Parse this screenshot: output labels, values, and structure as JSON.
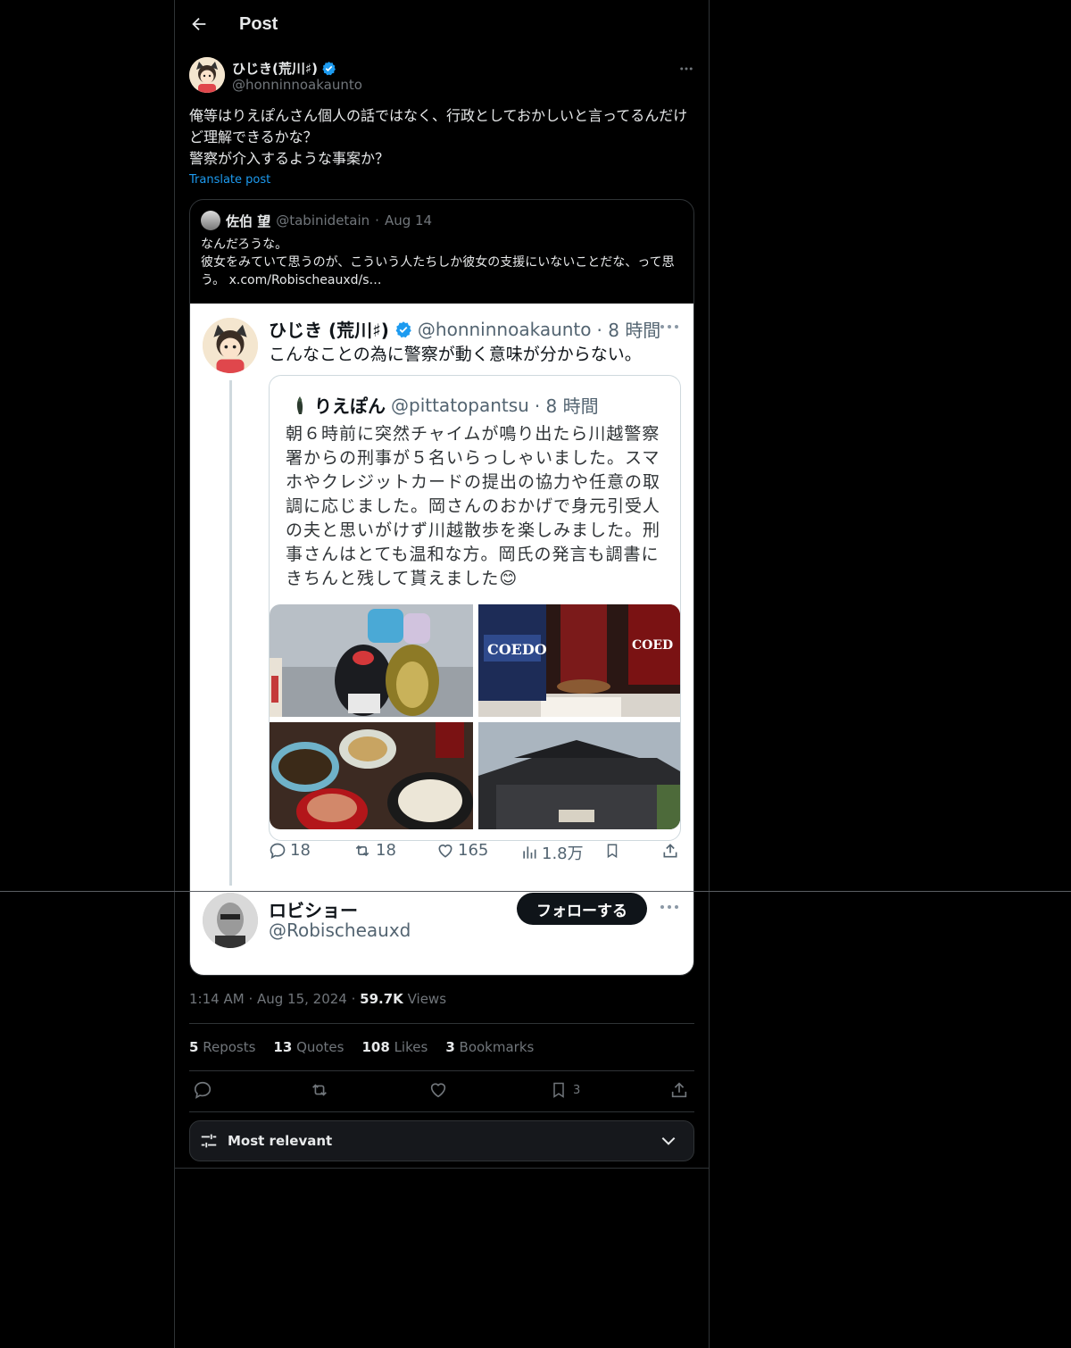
{
  "header": {
    "title": "Post"
  },
  "author": {
    "name": "ひじき(荒川♯)",
    "handle": "@honninnoakaunto"
  },
  "post": {
    "text": "俺等はりえぽんさん個人の話ではなく、行政としておかしいと言ってるんだけど理解できるかな？\n警察が介入するような事案か？",
    "translate_label": "Translate post"
  },
  "quote": {
    "name": "佐伯 望",
    "handle": "@tabinidetain",
    "date": "Aug 14",
    "text": "なんだろうな。\n彼女をみていて思うのが、こういう人たちしか彼女の支援にいないことだな、って思う。 x.com/Robischeauxd/s…",
    "screenshot": {
      "author_name": "ひじき (荒川♯)",
      "author_handle": "@honninnoakaunto",
      "time": "· 8 時間",
      "text": "こんなことの為に警察が動く意味が分からない。",
      "inner": {
        "name": "りえぽん",
        "handle": "@pittatopantsu",
        "time": "· 8 時間",
        "text": "朝６時前に突然チャイムが鳴り出たら川越警察署からの刑事が５名いらっしゃいました。スマホやクレジットカードの提出の協力や任意の取調に応じました。岡さんのおかげで身元引受人の夫と思いがけず川越散歩を楽しみました。刑事さんはとても温和な方。岡氏の発言も調書にきちんと残して貰えました😊"
      },
      "actions": {
        "replies": "18",
        "reposts": "18",
        "likes": "165",
        "views": "1.8万"
      },
      "reply": {
        "name": "ロビショー",
        "handle": "@Robischeauxd",
        "follow_label": "フォローする"
      }
    }
  },
  "meta": {
    "time": "1:14 AM",
    "date": "Aug 15, 2024",
    "views_count": "59.7K",
    "views_label": "Views"
  },
  "stats": [
    {
      "count": "5",
      "label": "Reposts"
    },
    {
      "count": "13",
      "label": "Quotes"
    },
    {
      "count": "108",
      "label": "Likes"
    },
    {
      "count": "3",
      "label": "Bookmarks"
    }
  ],
  "action_bar": {
    "bookmark_count": "3"
  },
  "sort": {
    "label": "Most relevant"
  },
  "colors": {
    "accent": "#1d9bf0",
    "background": "#000000",
    "border": "#2f3336",
    "muted": "#71767b"
  }
}
